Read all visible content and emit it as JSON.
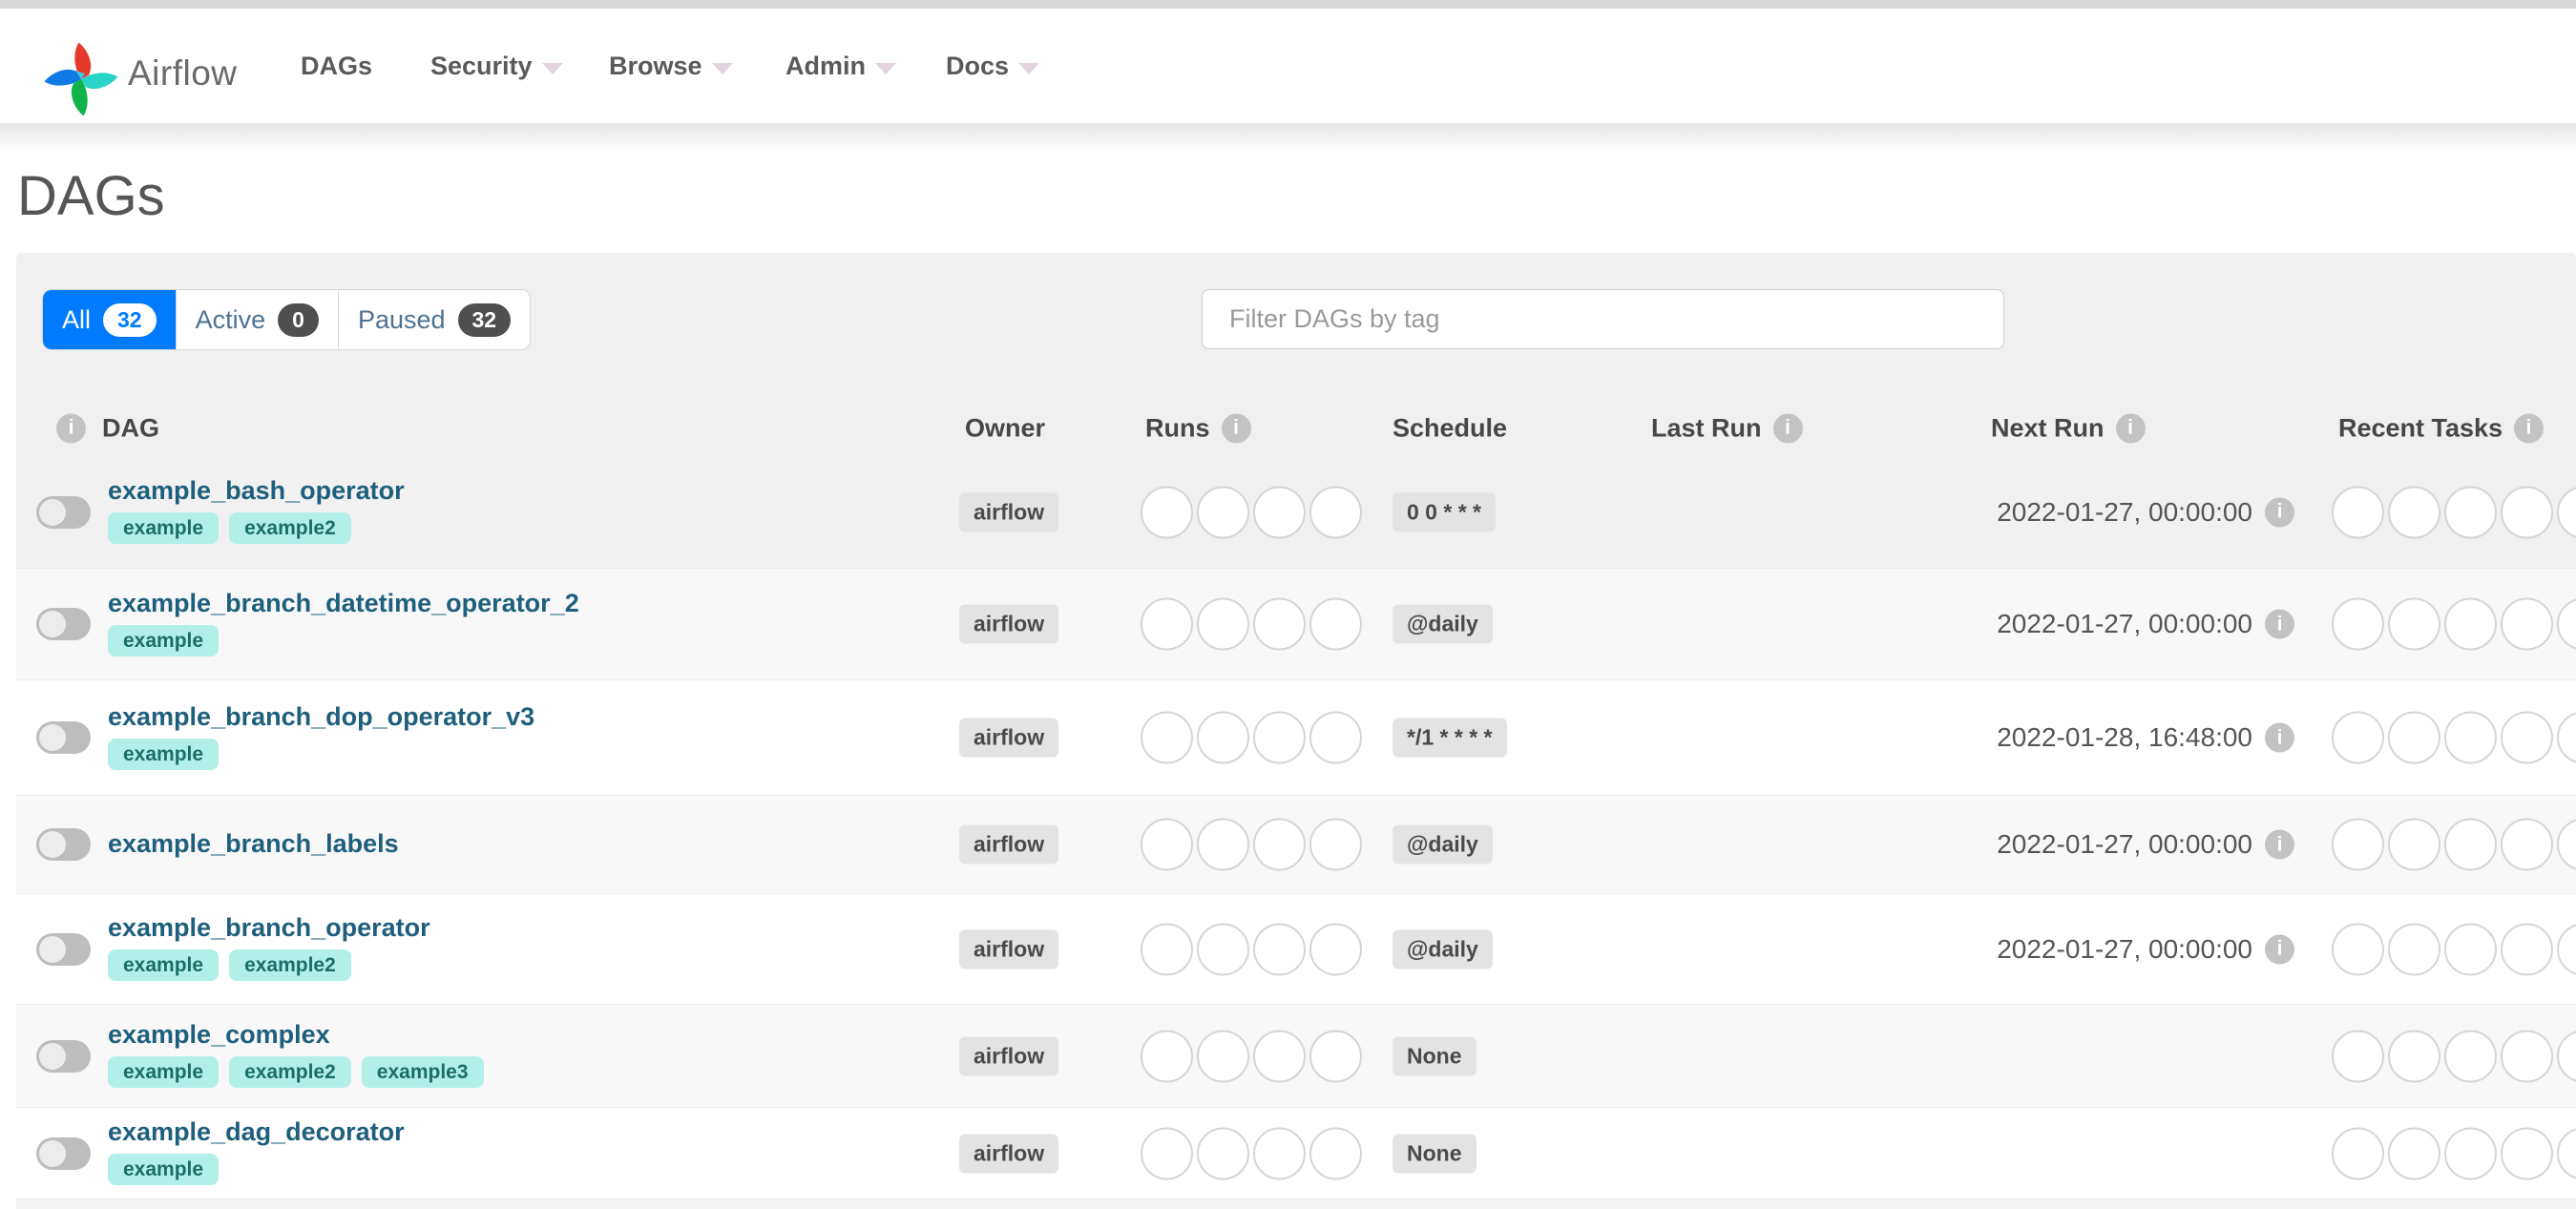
{
  "navbar": {
    "brand": "Airflow",
    "items": [
      {
        "label": "DAGs",
        "has_caret": false
      },
      {
        "label": "Security",
        "has_caret": true
      },
      {
        "label": "Browse",
        "has_caret": true
      },
      {
        "label": "Admin",
        "has_caret": true
      },
      {
        "label": "Docs",
        "has_caret": true
      }
    ]
  },
  "page": {
    "title": "DAGs"
  },
  "filters": {
    "tabs": [
      {
        "label": "All",
        "count": "32",
        "active": true
      },
      {
        "label": "Active",
        "count": "0",
        "active": false
      },
      {
        "label": "Paused",
        "count": "32",
        "active": false
      }
    ],
    "search_placeholder": "Filter DAGs by tag",
    "search_value": ""
  },
  "table": {
    "columns": {
      "dag": "DAG",
      "owner": "Owner",
      "runs": "Runs",
      "schedule": "Schedule",
      "last_run": "Last Run",
      "next_run": "Next Run",
      "recent_tasks": "Recent Tasks"
    },
    "runs_circle_count": 4,
    "recent_circle_count": 5,
    "rows": [
      {
        "name": "example_bash_operator",
        "tags": [
          "example",
          "example2"
        ],
        "owner": "airflow",
        "schedule": "0 0 * * *",
        "last_run": "",
        "next_run": "2022-01-27, 00:00:00",
        "paused": true
      },
      {
        "name": "example_branch_datetime_operator_2",
        "tags": [
          "example"
        ],
        "owner": "airflow",
        "schedule": "@daily",
        "last_run": "",
        "next_run": "2022-01-27, 00:00:00",
        "paused": true
      },
      {
        "name": "example_branch_dop_operator_v3",
        "tags": [
          "example"
        ],
        "owner": "airflow",
        "schedule": "*/1 * * * *",
        "last_run": "",
        "next_run": "2022-01-28, 16:48:00",
        "paused": true
      },
      {
        "name": "example_branch_labels",
        "tags": [],
        "owner": "airflow",
        "schedule": "@daily",
        "last_run": "",
        "next_run": "2022-01-27, 00:00:00",
        "paused": true
      },
      {
        "name": "example_branch_operator",
        "tags": [
          "example",
          "example2"
        ],
        "owner": "airflow",
        "schedule": "@daily",
        "last_run": "",
        "next_run": "2022-01-27, 00:00:00",
        "paused": true
      },
      {
        "name": "example_complex",
        "tags": [
          "example",
          "example2",
          "example3"
        ],
        "owner": "airflow",
        "schedule": "None",
        "last_run": "",
        "next_run": "",
        "paused": true
      },
      {
        "name": "example_dag_decorator",
        "tags": [
          "example"
        ],
        "owner": "airflow",
        "schedule": "None",
        "last_run": "",
        "next_run": "",
        "paused": true
      }
    ]
  },
  "colors": {
    "accent_blue": "#007bff",
    "dag_link": "#1e5f7d",
    "tag_background": "#b2efe8",
    "tag_text": "#1b6e68",
    "badge_background": "#e3e3e3",
    "badge_text": "#4a4a4a",
    "panel_background": "#f0f0f0",
    "row_stripe": "#f8f8f8",
    "row_hover": "#f1f1f1",
    "count_badge_dark": "#4f4f4f",
    "logo_red": "#e4392b",
    "logo_teal": "#29d3c8",
    "logo_green": "#11b34a",
    "logo_blue": "#0f7ae3"
  }
}
